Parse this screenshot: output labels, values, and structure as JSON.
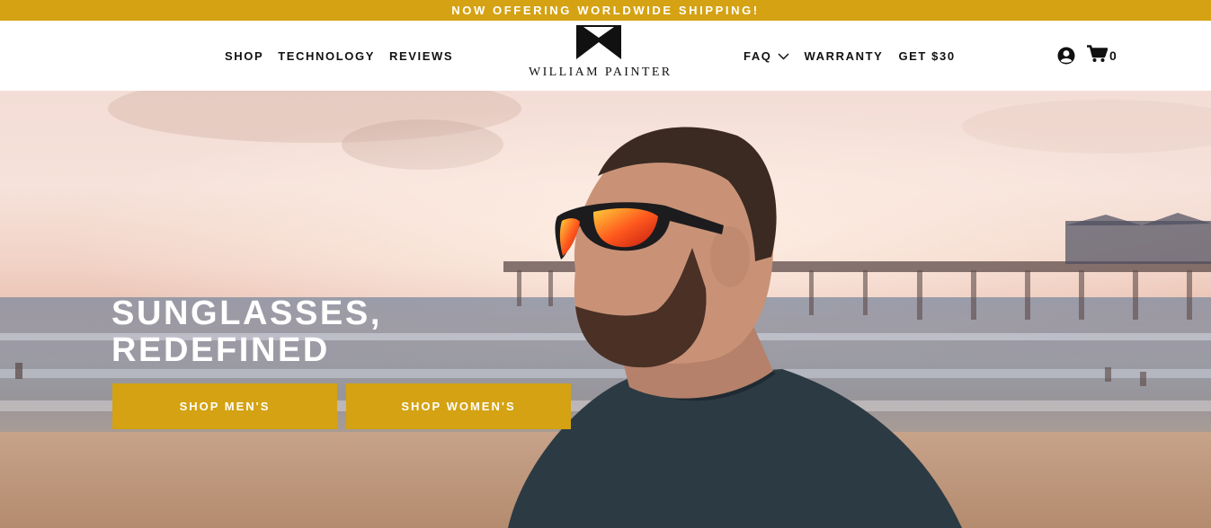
{
  "announcement": "NOW OFFERING WORLDWIDE SHIPPING!",
  "nav_left": [
    {
      "label": "SHOP"
    },
    {
      "label": "TECHNOLOGY"
    },
    {
      "label": "REVIEWS"
    }
  ],
  "logo": {
    "text": "WILLIAM PAINTER"
  },
  "nav_right": [
    {
      "label": "FAQ"
    },
    {
      "label": "WARRANTY"
    },
    {
      "label": "GET $30"
    }
  ],
  "cart": {
    "count": "0"
  },
  "hero": {
    "headline_line1": "SUNGLASSES,",
    "headline_line2": "REDEFINED",
    "buttons": [
      {
        "label": "SHOP MEN'S"
      },
      {
        "label": "SHOP WOMEN'S"
      }
    ]
  },
  "icons": {
    "account": "user-circle-icon",
    "cart": "cart-icon",
    "faq_dropdown": "chevron-down-icon"
  },
  "colors": {
    "accent": "#d4a212",
    "text": "#111111",
    "hero_text": "#ffffff"
  }
}
